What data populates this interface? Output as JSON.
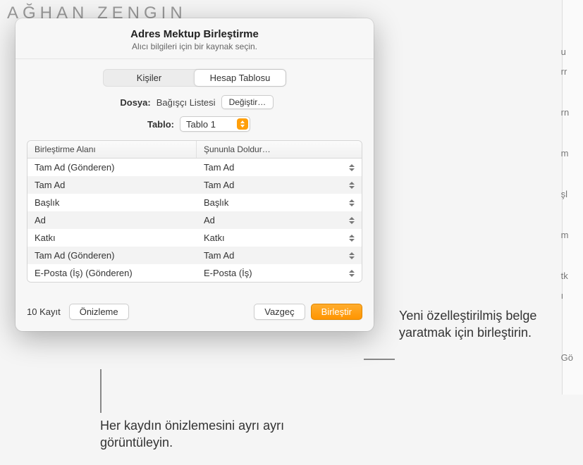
{
  "bg": {
    "faint_text": "AĞHAN ZENGIN",
    "side_glimpse": [
      "u",
      "rr",
      "rn",
      "m",
      "şl",
      "m",
      "tk",
      "ı",
      "Gö"
    ]
  },
  "dialog": {
    "title": "Adres Mektup Birleştirme",
    "subtitle": "Alıcı bilgileri için bir kaynak seçin.",
    "segmented": {
      "left": "Kişiler",
      "right": "Hesap Tablosu",
      "active": "right"
    },
    "file": {
      "label": "Dosya:",
      "value": "Bağışçı Listesi",
      "change_btn": "Değiştir…"
    },
    "table_select": {
      "label": "Tablo:",
      "value": "Tablo 1"
    },
    "columns": {
      "field": "Birleştirme Alanı",
      "populate": "Şununla Doldur…"
    },
    "rows": [
      {
        "field": "Tam Ad (Gönderen)",
        "populate": "Tam Ad"
      },
      {
        "field": "Tam Ad",
        "populate": "Tam Ad"
      },
      {
        "field": "Başlık",
        "populate": "Başlık"
      },
      {
        "field": "Ad",
        "populate": "Ad"
      },
      {
        "field": "Katkı",
        "populate": "Katkı"
      },
      {
        "field": "Tam Ad (Gönderen)",
        "populate": "Tam Ad"
      },
      {
        "field": "E-Posta (İş) (Gönderen)",
        "populate": "E-Posta (İş)"
      }
    ],
    "footer": {
      "count": "10 Kayıt",
      "preview": "Önizleme",
      "cancel": "Vazgeç",
      "merge": "Birleştir"
    }
  },
  "callouts": {
    "merge": "Yeni özelleştirilmiş belge yaratmak için birleştirin.",
    "preview": "Her kaydın önizlemesini ayrı ayrı görüntüleyin."
  }
}
